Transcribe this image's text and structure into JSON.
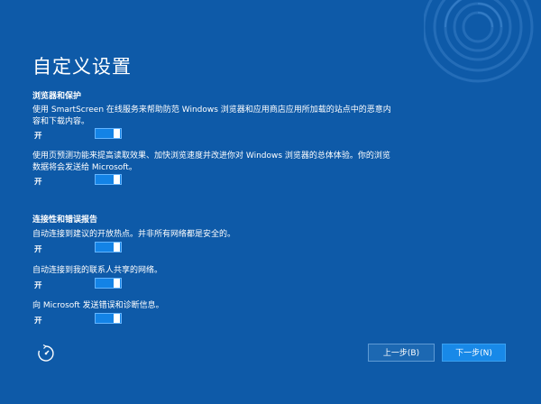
{
  "page_title": "自定义设置",
  "sections": [
    {
      "heading": "浏览器和保护",
      "settings": [
        {
          "description": "使用 SmartScreen 在线服务来帮助防范 Windows 浏览器和应用商店应用所加载的站点中的恶意内容和下载内容。",
          "state": "开",
          "on": true
        },
        {
          "description": "使用页预测功能来提高读取效果、加快浏览速度并改进你对 Windows 浏览器的总体体验。你的浏览数据将会发送给 Microsoft。",
          "state": "开",
          "on": true
        }
      ]
    },
    {
      "heading": "连接性和错误报告",
      "settings": [
        {
          "description": "自动连接到建议的开放热点。并非所有网络都是安全的。",
          "state": "开",
          "on": true
        },
        {
          "description": "自动连接到我的联系人共享的网络。",
          "state": "开",
          "on": true
        },
        {
          "description": "向 Microsoft 发送错误和诊断信息。",
          "state": "开",
          "on": true
        }
      ]
    }
  ],
  "buttons": {
    "back": "上一步(B)",
    "next": "下一步(N)"
  },
  "icons": {
    "accessibility": "ease-of-access-icon"
  },
  "colors": {
    "background": "#0e5aa8",
    "toggle_on": "#1383e6",
    "next_button": "#1889e8"
  }
}
